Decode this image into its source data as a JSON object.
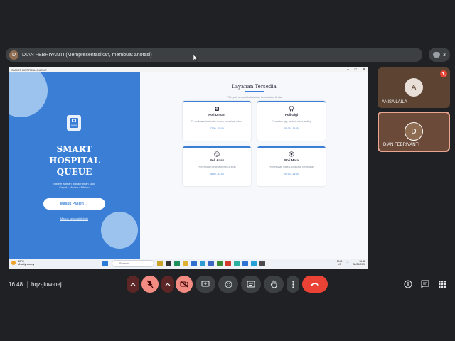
{
  "presenter_bar": {
    "initial": "D",
    "label": "DIAN FEBRIYANTI (Mempresentasikan, membuat anotasi)"
  },
  "participants_count": "3",
  "shared_window": {
    "title": "SMART HOSPITAL QUEUE",
    "left": {
      "brand_lines": [
        "SMART",
        "HOSPITAL",
        "QUEUE"
      ],
      "tagline": "Sistem antrian digital rumah sakit",
      "tagline2": "Cepat • Mudah • Efisien",
      "enter_button": "Masuk Pasien →",
      "admin_link": "Masuk sebagai Admin"
    },
    "right": {
      "title": "Layanan Tersedia",
      "subtitle": "Pilih poli sesuai kebutuhan kesehatan Anda",
      "cards": [
        {
          "icon": "hospital-icon",
          "name": "Poli Umum",
          "desc": "Pemeriksaan kesehatan umum, konsultasi dokter",
          "time": "07:00 - 15:00"
        },
        {
          "icon": "tooth-icon",
          "name": "Poli Gigi",
          "desc": "Perawatan gigi, tambal, cabut, scaling",
          "time": "08:00 - 14:00"
        },
        {
          "icon": "baby-icon",
          "name": "Poli Anak",
          "desc": "Pemeriksaan kesehatan bayi & anak",
          "time": "08:00 - 13:00"
        },
        {
          "icon": "eye-icon",
          "name": "Poli Mata",
          "desc": "Pemeriksaan mata & konsultasi penglihatan",
          "time": "09:00 - 14:00"
        }
      ]
    },
    "taskbar": {
      "temperature": "32°C",
      "weather": "Mostly sunny",
      "search": "Search",
      "lang": "ENG",
      "region": "US",
      "time": "16:48",
      "date": "08/06/2026"
    }
  },
  "tiles": [
    {
      "initial": "A",
      "name": "ANISA LAILA",
      "muted": true
    },
    {
      "initial": "D",
      "name": "DIAN FEBRIYANTI",
      "muted": false
    }
  ],
  "meeting": {
    "time": "16.48",
    "code": "hqz-jiuw-nej"
  },
  "colors": {
    "accent": "#3a7fd5",
    "hangup": "#ea4335",
    "muted_btn": "#f28b82"
  }
}
